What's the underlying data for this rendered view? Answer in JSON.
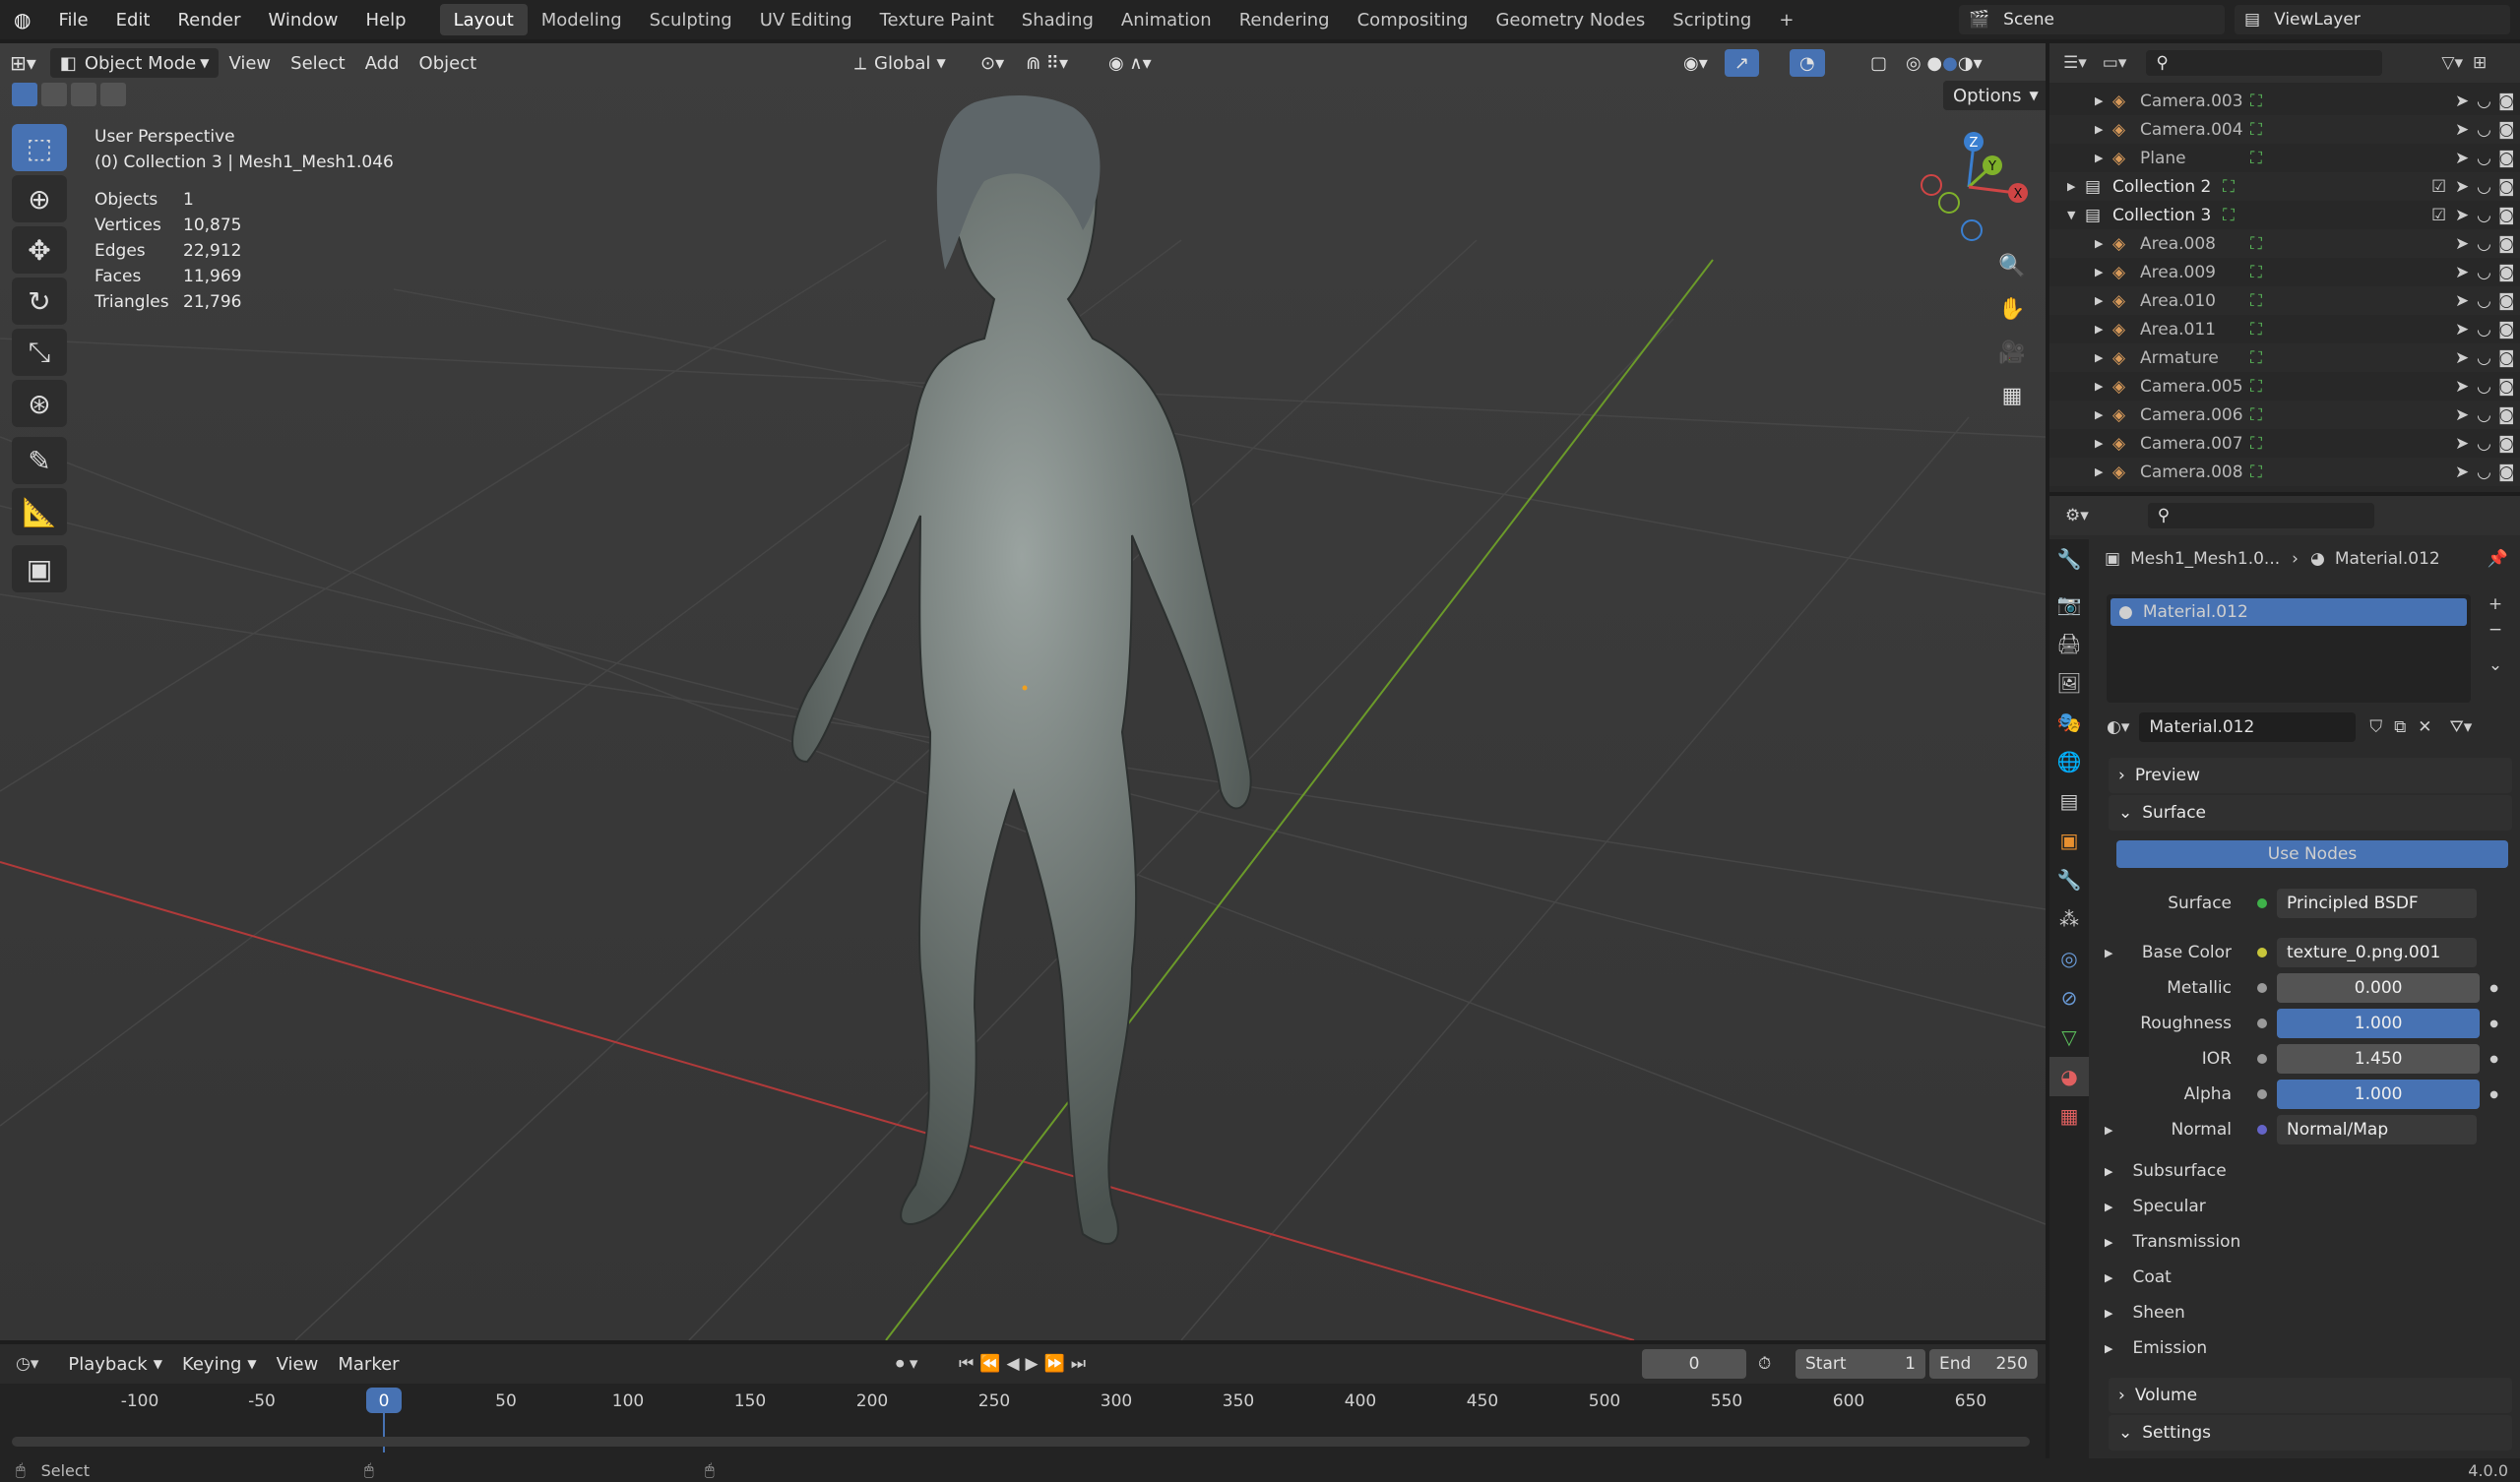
{
  "menu": {
    "file": "File",
    "edit": "Edit",
    "render": "Render",
    "window": "Window",
    "help": "Help"
  },
  "workspaces": [
    "Layout",
    "Modeling",
    "Sculpting",
    "UV Editing",
    "Texture Paint",
    "Shading",
    "Animation",
    "Rendering",
    "Compositing",
    "Geometry Nodes",
    "Scripting"
  ],
  "scene": "Scene",
  "view_layer": "ViewLayer",
  "viewport": {
    "mode": "Object Mode",
    "view": "View",
    "select": "Select",
    "add": "Add",
    "object": "Object",
    "transform": "Global",
    "options": "Options",
    "perspective": "User Perspective",
    "active": "(0) Collection 3 | Mesh1_Mesh1.046",
    "stats": [
      {
        "k": "Objects",
        "v": "1"
      },
      {
        "k": "Vertices",
        "v": "10,875"
      },
      {
        "k": "Edges",
        "v": "22,912"
      },
      {
        "k": "Faces",
        "v": "11,969"
      },
      {
        "k": "Triangles",
        "v": "21,796"
      }
    ],
    "gizmo": {
      "z": "Z",
      "y": "Y",
      "x": "X"
    }
  },
  "outliner": [
    {
      "name": "Camera.003",
      "indent": 2
    },
    {
      "name": "Camera.004",
      "indent": 2
    },
    {
      "name": "Plane",
      "indent": 2
    },
    {
      "name": "Collection 2",
      "indent": 1
    },
    {
      "name": "Collection 3",
      "indent": 1
    },
    {
      "name": "Area.008",
      "indent": 2
    },
    {
      "name": "Area.009",
      "indent": 2
    },
    {
      "name": "Area.010",
      "indent": 2
    },
    {
      "name": "Area.011",
      "indent": 2
    },
    {
      "name": "Armature",
      "indent": 2
    },
    {
      "name": "Camera.005",
      "indent": 2
    },
    {
      "name": "Camera.006",
      "indent": 2
    },
    {
      "name": "Camera.007",
      "indent": 2
    },
    {
      "name": "Camera.008",
      "indent": 2
    }
  ],
  "properties": {
    "breadcrumb_obj": "Mesh1_Mesh1.0...",
    "breadcrumb_mat": "Material.012",
    "slot": "Material.012",
    "material": "Material.012",
    "preview": "Preview",
    "surface_panel": "Surface",
    "use_nodes": "Use Nodes",
    "rows": [
      {
        "label": "Surface",
        "value": "Principled BSDF",
        "kind": "left",
        "dot": "#3fb14a"
      },
      {
        "label": "Base Color",
        "value": "texture_0.png.001",
        "kind": "left",
        "dot": "#c8c63a"
      },
      {
        "label": "Metallic",
        "value": "0.000",
        "kind": "grey",
        "dot": "#9a9a9a"
      },
      {
        "label": "Roughness",
        "value": "1.000",
        "kind": "blue",
        "dot": "#9a9a9a"
      },
      {
        "label": "IOR",
        "value": "1.450",
        "kind": "grey",
        "dot": "#9a9a9a"
      },
      {
        "label": "Alpha",
        "value": "1.000",
        "kind": "blue",
        "dot": "#9a9a9a"
      },
      {
        "label": "Normal",
        "value": "Normal/Map",
        "kind": "left",
        "dot": "#6464c8"
      }
    ],
    "subpanels": [
      "Subsurface",
      "Specular",
      "Transmission",
      "Coat",
      "Sheen",
      "Emission"
    ],
    "volume": "Volume",
    "settings": "Settings"
  },
  "timeline": {
    "playback": "Playback",
    "keying": "Keying",
    "view": "View",
    "marker": "Marker",
    "frame": "0",
    "start_label": "Start",
    "start": "1",
    "end_label": "End",
    "end": "250",
    "ticks": [
      "-100",
      "-50",
      "0",
      "50",
      "100",
      "150",
      "200",
      "250",
      "300",
      "350",
      "400",
      "450",
      "500",
      "550",
      "600",
      "650"
    ]
  },
  "status": {
    "select": "Select",
    "version": "4.0.0"
  }
}
